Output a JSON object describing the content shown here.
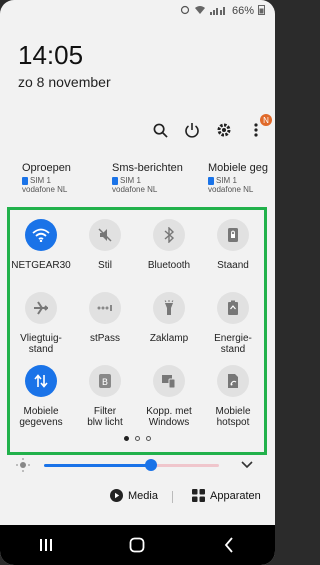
{
  "status_bar": {
    "battery": "66%"
  },
  "clock": {
    "time": "14:05",
    "date": "zo 8 november"
  },
  "header_actions": {
    "notification_badge": "N"
  },
  "sim_cards": [
    {
      "title": "Oproepen",
      "sim": "SIM 1",
      "carrier": "vodafone NL"
    },
    {
      "title": "Sms-berichten",
      "sim": "SIM 1",
      "carrier": "vodafone NL"
    },
    {
      "title": "Mobiele geg",
      "sim": "SIM 1",
      "carrier": "vodafone NL"
    }
  ],
  "quick_tiles": [
    {
      "label": "NETGEAR30",
      "label2": "",
      "icon": "wifi-icon",
      "active": true
    },
    {
      "label": "Stil",
      "label2": "",
      "icon": "mute-icon",
      "active": false
    },
    {
      "label": "Bluetooth",
      "label2": "",
      "icon": "bluetooth-icon",
      "active": false
    },
    {
      "label": "Staand",
      "label2": "",
      "icon": "portrait-lock-icon",
      "active": false
    },
    {
      "label": "Vliegtuig-",
      "label2": "stand",
      "icon": "airplane-icon",
      "active": false
    },
    {
      "label": "stPass",
      "label2": "",
      "icon": "smartpass-icon",
      "active": false
    },
    {
      "label": "Zaklamp",
      "label2": "",
      "icon": "flashlight-icon",
      "active": false
    },
    {
      "label": "Energie-",
      "label2": "stand",
      "icon": "power-saving-icon",
      "active": false
    },
    {
      "label": "Mobiele",
      "label2": "gegevens",
      "icon": "mobile-data-icon",
      "active": true
    },
    {
      "label": "Filter",
      "label2": "blw licht",
      "icon": "blue-light-filter-icon",
      "active": false
    },
    {
      "label": "Kopp. met",
      "label2": "Windows",
      "icon": "link-windows-icon",
      "active": false
    },
    {
      "label": "Mobiele",
      "label2": "hotspot",
      "icon": "hotspot-icon",
      "active": false
    }
  ],
  "pages": {
    "count": 3,
    "active": 1
  },
  "brightness": {
    "level": 0.52
  },
  "bottom_actions": {
    "media_label": "Media",
    "devices_label": "Apparaten"
  },
  "colors": {
    "accent": "#1a73e8",
    "highlight": "#21b14b",
    "badge": "#e06a2a"
  }
}
